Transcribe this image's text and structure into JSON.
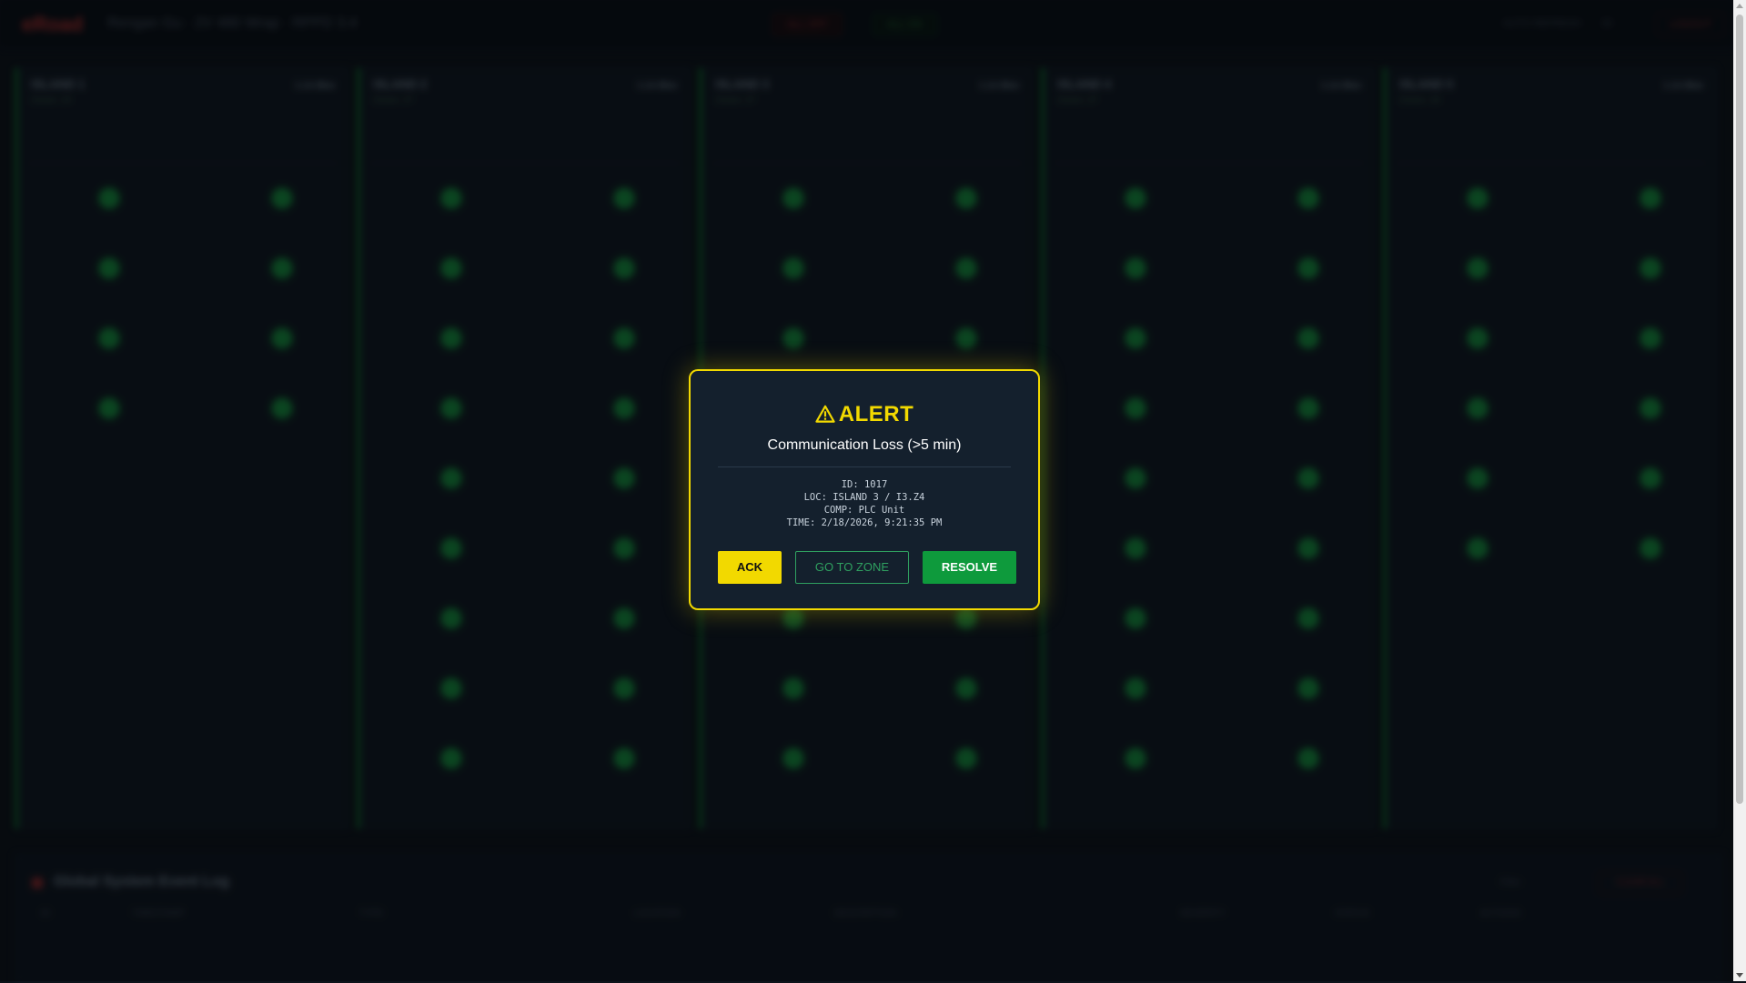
{
  "header": {
    "brand": "eRoad",
    "subtitle": "Rengan Gu · 2V 480 Wrap · RPPD 3.4",
    "btn_red": "ALL OFF",
    "btn_green": "ALL ON",
    "right_text": "AUTO REFRESH",
    "right_count": "30",
    "logout": "LOGOUT"
  },
  "islands": [
    {
      "title": "ISLAND 1",
      "sub": "Zones: 24",
      "right": "1.1A Bkw"
    },
    {
      "title": "ISLAND 2",
      "sub": "Zones: 27",
      "right": "1.1A Bkw"
    },
    {
      "title": "ISLAND 3",
      "sub": "Zones: 27",
      "right": "1.1A Bkw"
    },
    {
      "title": "ISLAND 4",
      "sub": "Zones: 27",
      "right": "1.1A Bkw"
    },
    {
      "title": "ISLAND 5",
      "sub": "Zones: 18",
      "right": "1.1A Bkw"
    }
  ],
  "event_log": {
    "title": "Global System Event Log",
    "tools": "Filter",
    "clear": "CLEAR ALL",
    "columns": [
      "ID",
      "TIMESTAMP",
      "TYPE",
      "LOCATION",
      "DESCRIPTION",
      "SEVERITY",
      "STATUS",
      "ACTIONS"
    ]
  },
  "alert": {
    "title": "ALERT",
    "message": "Communication Loss (>5 min)",
    "id_line": "ID: 1017",
    "loc_line": "LOC: ISLAND 3 / I3.Z4",
    "comp_line": "COMP: PLC Unit",
    "time_line": "TIME: 2/18/2026, 9:21:35 PM",
    "ack_label": "ACK",
    "zone_label": "GO TO ZONE",
    "resolve_label": "RESOLVE"
  },
  "colors": {
    "alert_accent": "#f2d900",
    "ok_green": "#19b54a",
    "danger_red": "#e53935"
  }
}
